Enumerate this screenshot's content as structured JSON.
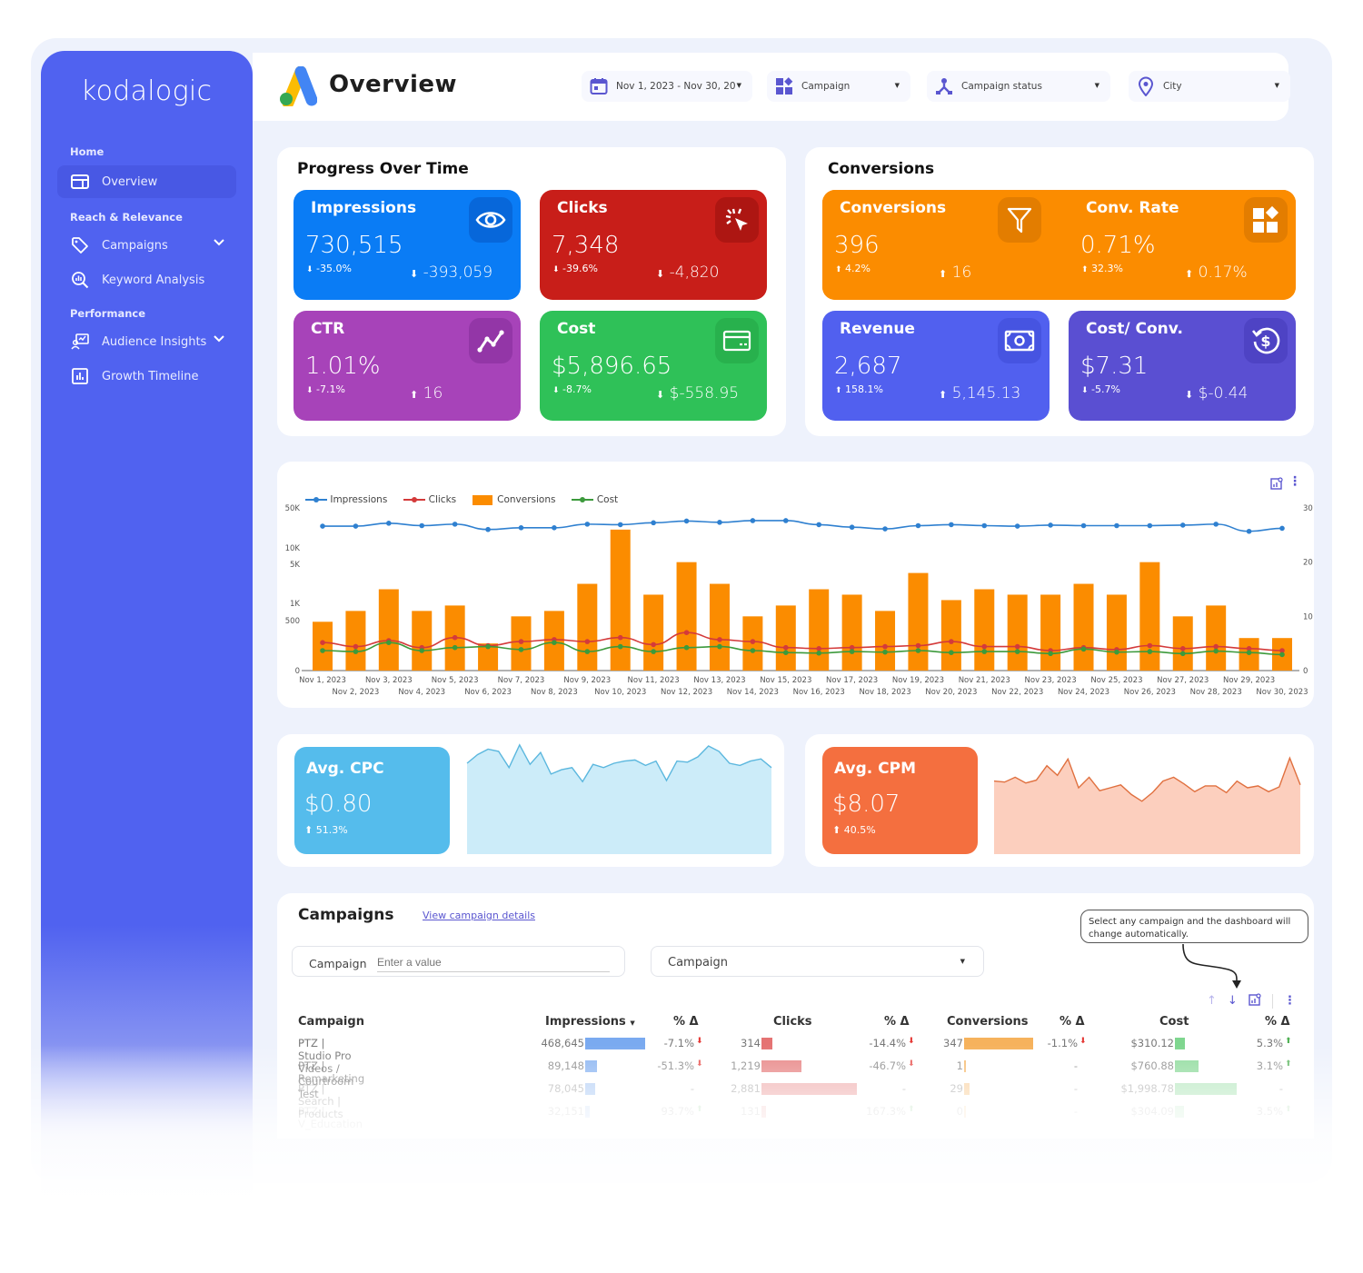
{
  "brand": "kodalogic",
  "page": {
    "title": "Overview"
  },
  "sidebar": {
    "sections": [
      {
        "label": "Home",
        "items": [
          {
            "label": "Overview",
            "icon": "layout-icon",
            "active": true
          }
        ]
      },
      {
        "label": "Reach & Relevance",
        "items": [
          {
            "label": "Campaigns",
            "icon": "tag-icon",
            "expandable": true
          },
          {
            "label": "Keyword Analysis",
            "icon": "search-chart-icon"
          }
        ]
      },
      {
        "label": "Performance",
        "items": [
          {
            "label": "Audience Insights",
            "icon": "audience-icon",
            "expandable": true
          },
          {
            "label": "Growth Timeline",
            "icon": "bar-chart-icon"
          }
        ]
      }
    ]
  },
  "filters": {
    "date": "Nov 1, 2023 - Nov 30, 20",
    "campaign": "Campaign",
    "campaign_status": "Campaign status",
    "city": "City"
  },
  "progress": {
    "title": "Progress Over Time",
    "cards": [
      {
        "title": "Impressions",
        "value": "730,515",
        "pct": "-35.0%",
        "delta": "-393,059",
        "pct_dir": "down",
        "delta_dir": "down",
        "icon": "eye-icon",
        "color": "#0a7cf5"
      },
      {
        "title": "Clicks",
        "value": "7,348",
        "pct": "-39.6%",
        "delta": "-4,820",
        "pct_dir": "down",
        "delta_dir": "down",
        "icon": "click-icon",
        "color": "#c81e19"
      },
      {
        "title": "CTR",
        "value": "1.01%",
        "pct": "-7.1%",
        "delta": "16",
        "pct_dir": "down",
        "delta_dir": "up",
        "icon": "trend-icon",
        "color": "#a743b9"
      },
      {
        "title": "Cost",
        "value": "$5,896.65",
        "pct": "-8.7%",
        "delta": "$-558.95",
        "pct_dir": "down",
        "delta_dir": "down",
        "icon": "credit-card-icon",
        "color": "#2fc158"
      }
    ]
  },
  "conversions": {
    "title": "Conversions",
    "cards": [
      {
        "title": "Conversions",
        "value": "396",
        "pct": "4.2%",
        "delta": "16",
        "pct_dir": "up",
        "delta_dir": "up",
        "icon": "funnel-icon",
        "color": "#fb8c00"
      },
      {
        "title": "Conv. Rate",
        "value": "0.71%",
        "pct": "32.3%",
        "delta": "0.17%",
        "pct_dir": "up",
        "delta_dir": "up",
        "icon": "widgets-icon",
        "color": "#fb8c00"
      },
      {
        "title": "Revenue",
        "value": "2,687",
        "pct": "158.1%",
        "delta": "5,145.13",
        "pct_dir": "up",
        "delta_dir": "up",
        "icon": "money-icon",
        "color": "#5160ef"
      },
      {
        "title": "Cost/ Conv.",
        "value": "$7.31",
        "pct": "-5.7%",
        "delta": "$-0.44",
        "pct_dir": "down",
        "delta_dir": "down",
        "icon": "dollar-refresh-icon",
        "color": "#5a4fd2"
      }
    ]
  },
  "chart_data": [
    {
      "type": "bar",
      "title": "",
      "legend": [
        "Impressions",
        "Clicks",
        "Conversions",
        "Cost"
      ],
      "legend_position": "top-left",
      "categories": [
        "Nov 1, 2023",
        "Nov 2, 2023",
        "Nov 3, 2023",
        "Nov 4, 2023",
        "Nov 5, 2023",
        "Nov 6, 2023",
        "Nov 7, 2023",
        "Nov 8, 2023",
        "Nov 9, 2023",
        "Nov 10, 2023",
        "Nov 11, 2023",
        "Nov 12, 2023",
        "Nov 13, 2023",
        "Nov 14, 2023",
        "Nov 15, 2023",
        "Nov 16, 2023",
        "Nov 17, 2023",
        "Nov 18, 2023",
        "Nov 19, 2023",
        "Nov 20, 2023",
        "Nov 21, 2023",
        "Nov 22, 2023",
        "Nov 23, 2023",
        "Nov 24, 2023",
        "Nov 25, 2023",
        "Nov 26, 2023",
        "Nov 27, 2023",
        "Nov 28, 2023",
        "Nov 29, 2023",
        "Nov 30, 2023"
      ],
      "left_axis": {
        "scale": "log",
        "ticks": [
          "0",
          "500",
          "1K",
          "5K",
          "10K",
          "50K"
        ]
      },
      "right_axis": {
        "ticks": [
          "0",
          "10",
          "20",
          "30"
        ],
        "range": [
          0,
          30
        ]
      },
      "series": [
        {
          "name": "Impressions",
          "type": "line",
          "axis": "left",
          "color": "#2f80d0",
          "values": [
            24000,
            24000,
            27000,
            24500,
            26000,
            21000,
            22500,
            22500,
            26000,
            25500,
            27500,
            29500,
            28000,
            30000,
            30000,
            25500,
            23000,
            21500,
            24500,
            25500,
            24500,
            24000,
            25000,
            24500,
            24500,
            24500,
            25000,
            26000,
            19500,
            22000
          ]
        },
        {
          "name": "Clicks",
          "type": "line",
          "axis": "left",
          "color": "#d43a3a",
          "values": [
            280,
            240,
            300,
            230,
            330,
            250,
            290,
            310,
            290,
            330,
            260,
            380,
            310,
            290,
            230,
            220,
            230,
            240,
            250,
            290,
            240,
            240,
            200,
            230,
            210,
            250,
            220,
            240,
            220,
            200
          ]
        },
        {
          "name": "Conversions",
          "type": "bar",
          "axis": "right",
          "color": "#fb8c00",
          "values": [
            9,
            11,
            15,
            11,
            12,
            5,
            10,
            11,
            16,
            26,
            14,
            20,
            16,
            10,
            12,
            15,
            14,
            11,
            18,
            13,
            15,
            14,
            14,
            16,
            14,
            20,
            10,
            12,
            6,
            6
          ]
        },
        {
          "name": "Cost",
          "type": "line",
          "axis": "left",
          "color": "#3c9a3c",
          "values": [
            200,
            190,
            280,
            200,
            230,
            240,
            210,
            280,
            190,
            240,
            190,
            230,
            240,
            200,
            180,
            175,
            190,
            185,
            200,
            180,
            190,
            190,
            170,
            215,
            185,
            190,
            170,
            195,
            180,
            160
          ]
        }
      ]
    },
    {
      "type": "area",
      "title": "Avg. CPC",
      "color": "#5bbbea",
      "x": "Nov 1, 2023 - Nov 30, 2023",
      "values": [
        0.84,
        0.92,
        0.97,
        0.95,
        0.8,
        1.01,
        0.83,
        0.94,
        0.74,
        0.78,
        0.8,
        0.67,
        0.83,
        0.8,
        0.84,
        0.86,
        0.87,
        0.82,
        0.86,
        0.68,
        0.86,
        0.85,
        0.9,
        1.0,
        0.95,
        0.84,
        0.82,
        0.86,
        0.88,
        0.8
      ]
    },
    {
      "type": "area",
      "title": "Avg. CPM",
      "color": "#f06f3f",
      "x": "Nov 1, 2023 - Nov 30, 2023",
      "values": [
        7.6,
        7.5,
        8.0,
        7.4,
        7.7,
        9.2,
        8.2,
        9.9,
        6.9,
        8.0,
        6.6,
        6.9,
        7.2,
        6.2,
        5.5,
        6.4,
        7.6,
        8.0,
        7.3,
        6.5,
        7.1,
        7.1,
        6.4,
        7.6,
        6.9,
        7.1,
        6.5,
        7.0,
        10.0,
        7.2
      ]
    }
  ],
  "avg_cpc": {
    "title": "Avg. CPC",
    "value": "$0.80",
    "pct": "51.3%",
    "pct_dir": "up"
  },
  "avg_cpm": {
    "title": "Avg. CPM",
    "value": "$8.07",
    "pct": "40.5%",
    "pct_dir": "up"
  },
  "campaigns": {
    "title": "Campaigns",
    "link": "View campaign details",
    "search_label": "Campaign",
    "search_placeholder": "Enter a value",
    "dropdown_value": "Campaign",
    "callout": "Select any campaign and the dashboard will change automatically.",
    "columns": [
      "Campaign",
      "Impressions",
      "% Δ",
      "Clicks",
      "% Δ",
      "Conversions",
      "% Δ",
      "Cost",
      "% Δ"
    ],
    "rows": [
      {
        "name": "PTZ | Studio Pro Videos / Courtroom Test",
        "impressions": "468,645",
        "imp_frac": 1.0,
        "imp_pct": "-7.1%",
        "imp_dir": "down",
        "clicks": "314",
        "clk_frac": 0.11,
        "clk_pct": "-14.4%",
        "clk_dir": "down",
        "conv": "347",
        "conv_frac": 1.0,
        "conv_pct": "-1.1%",
        "conv_dir": "down",
        "cost": "$310.12",
        "cost_frac": 0.16,
        "cost_pct": "5.3%",
        "cost_dir": "up"
      },
      {
        "name": "PTZ | Remarketing",
        "impressions": "89,148",
        "imp_frac": 0.19,
        "imp_pct": "-51.3%",
        "imp_dir": "down",
        "clicks": "1,219",
        "clk_frac": 0.42,
        "clk_pct": "-46.7%",
        "clk_dir": "down",
        "conv": "1",
        "conv_frac": 0.003,
        "conv_pct": "-",
        "conv_dir": "",
        "cost": "$760.88",
        "cost_frac": 0.38,
        "cost_pct": "3.1%",
        "cost_dir": "up"
      },
      {
        "name": "PTZ | Search | Products",
        "impressions": "78,045",
        "imp_frac": 0.17,
        "imp_pct": "-",
        "imp_dir": "",
        "clicks": "2,881",
        "clk_frac": 1.0,
        "clk_pct": "-",
        "clk_dir": "",
        "conv": "29",
        "conv_frac": 0.08,
        "conv_pct": "-",
        "conv_dir": "",
        "cost": "$1,998.78",
        "cost_frac": 1.0,
        "cost_pct": "-",
        "cost_dir": ""
      },
      {
        "name": "PTZ | V_Education",
        "impressions": "32,151",
        "imp_frac": 0.07,
        "imp_pct": "93.7%",
        "imp_dir": "up",
        "clicks": "131",
        "clk_frac": 0.05,
        "clk_pct": "167.3%",
        "clk_dir": "up",
        "conv": "0",
        "conv_frac": 0.0,
        "conv_pct": "-",
        "conv_dir": "",
        "cost": "$304.09",
        "cost_frac": 0.15,
        "cost_pct": "3.5%",
        "cost_dir": "up"
      }
    ]
  }
}
